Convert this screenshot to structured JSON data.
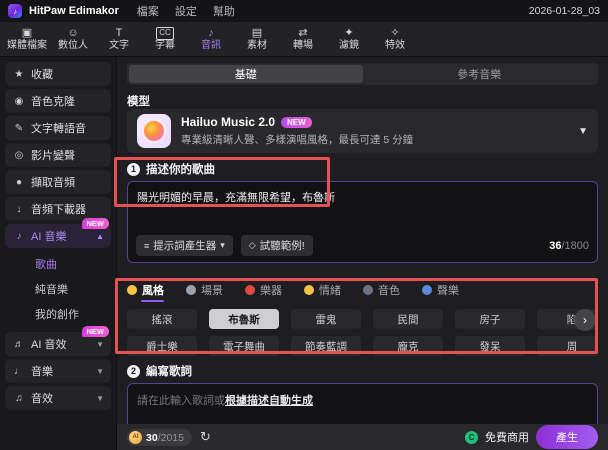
{
  "colors": {
    "accent": "#a77ef5",
    "annotation_red": "#e25352",
    "new_badge": "#e04fd4",
    "commercial_green": "#21c07a",
    "generate_gradient": "#8b2fd6"
  },
  "titlebar": {
    "app": "HitPaw Edimakor",
    "menus": [
      {
        "label": "檔案"
      },
      {
        "label": "設定"
      },
      {
        "label": "幫助"
      }
    ],
    "date": "2026-01-28_03"
  },
  "toolbar": {
    "items": [
      {
        "label": "媒體檔案",
        "glyph": "▣"
      },
      {
        "label": "數位人",
        "glyph": "☺"
      },
      {
        "label": "文字",
        "glyph": "T"
      },
      {
        "label": "字幕",
        "glyph": "CC"
      },
      {
        "label": "音訊",
        "glyph": "♪",
        "active": true
      },
      {
        "label": "素材",
        "glyph": "▤"
      },
      {
        "label": "轉場",
        "glyph": "⇄"
      },
      {
        "label": "濾鏡",
        "glyph": "✦"
      },
      {
        "label": "特效",
        "glyph": "✧"
      }
    ]
  },
  "sidebar": {
    "items": [
      {
        "glyph": "★",
        "label": "收藏"
      },
      {
        "glyph": "◉",
        "label": "音色克隆"
      },
      {
        "glyph": "✎",
        "label": "文字轉語音"
      },
      {
        "glyph": "◎",
        "label": "影片變聲"
      },
      {
        "glyph": "●",
        "label": "擷取音頻"
      },
      {
        "glyph": "↓",
        "label": "音頻下載器"
      }
    ],
    "ai_music": {
      "glyph": "♪",
      "label": "AI 音樂",
      "badge": "NEW",
      "arrow": "▲"
    },
    "ai_music_subs": [
      {
        "label": "歌曲",
        "active": true
      },
      {
        "label": "純音樂"
      },
      {
        "label": "我的創作"
      }
    ],
    "groups": [
      {
        "glyph": "♬",
        "label": "AI 音效",
        "badge": "NEW",
        "arrow": "▼"
      },
      {
        "glyph": "♩",
        "label": "音樂",
        "arrow": "▼"
      },
      {
        "glyph": "♫",
        "label": "音效",
        "arrow": "▼"
      }
    ]
  },
  "main": {
    "tabs": [
      {
        "label": "基礎",
        "active": true
      },
      {
        "label": "參考音樂"
      }
    ],
    "model": {
      "section_label": "模型",
      "name": "Hailuo Music 2.0",
      "badge": "NEW",
      "desc": "專業級清晰人聲、多樣演唱風格，最長可達 5 分鐘",
      "chevron": "▼"
    },
    "describe": {
      "num": "1",
      "title": "描述你的歌曲",
      "text": "陽光明媚的早晨，充滿無限希望，布魯斯",
      "prompt_generator": "提示詞產生器",
      "prompt_glyph": "≡",
      "prompt_arrow": "▾",
      "sample": "試聽範例!",
      "sample_glyph": "◇",
      "count": "36",
      "limit": "/1800"
    },
    "tags": {
      "categories": [
        {
          "label": "風格",
          "active": true,
          "icon_style": "background:#f5c542"
        },
        {
          "label": "場景",
          "icon_style": "background:#9ca3af"
        },
        {
          "label": "樂器",
          "icon_style": "background:#e0483f"
        },
        {
          "label": "情緒",
          "icon_style": "background:#f5c542"
        },
        {
          "label": "音色",
          "icon_style": "background:#6b7280"
        },
        {
          "label": "聲樂",
          "icon_style": "background:#5b8bd9"
        }
      ],
      "rows": [
        [
          "搖滾",
          "布魯斯",
          "雷鬼",
          "民間",
          "房子",
          "陷"
        ],
        [
          "爵士樂",
          "電子舞曲",
          "節奏藍調",
          "龐克",
          "發呆",
          "周"
        ]
      ],
      "scroll_arrow": "›"
    },
    "lyrics": {
      "num": "2",
      "title": "編寫歌詞",
      "placeholder": "請在此輸入歌詞或",
      "placeholder_link": "根據描述自動生成"
    },
    "footer": {
      "credits": "30",
      "credits_total": "/2015",
      "ai_coin": "AI",
      "refresh_glyph": "↻",
      "commercial_glyph": "C",
      "commercial": "免費商用",
      "generate": "產生"
    }
  }
}
